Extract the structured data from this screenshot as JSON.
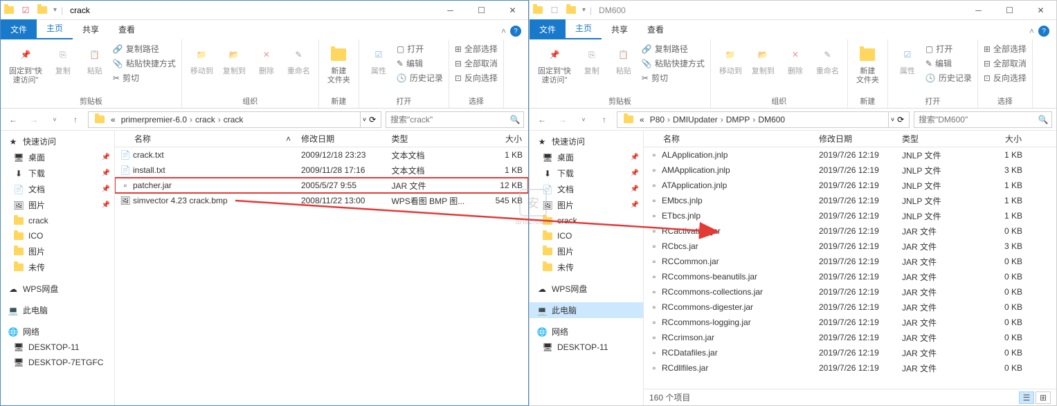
{
  "left": {
    "title": "crack",
    "tabs": {
      "file": "文件",
      "home": "主页",
      "share": "共享",
      "view": "查看"
    },
    "ribbon": {
      "pin": "固定到\"快\n速访问\"",
      "copy": "复制",
      "paste": "粘贴",
      "copypath": "复制路径",
      "pasteshortcut": "粘贴快捷方式",
      "cut": "剪切",
      "clipboard": "剪贴板",
      "moveto": "移动到",
      "copyto": "复制到",
      "delete": "删除",
      "rename": "重命名",
      "organize": "组织",
      "newfolder": "新建\n文件夹",
      "new": "新建",
      "properties": "属性",
      "open_sm": "打开",
      "edit_sm": "编辑",
      "history_sm": "历史记录",
      "open": "打开",
      "selectall": "全部选择",
      "selectnone": "全部取消",
      "invert": "反向选择",
      "select": "选择"
    },
    "breadcrumbs": [
      "«",
      "primerpremier-6.0",
      "crack",
      "crack"
    ],
    "search_placeholder": "搜索\"crack\"",
    "columns": {
      "name": "名称",
      "date": "修改日期",
      "type": "类型",
      "size": "大小"
    },
    "files": [
      {
        "name": "crack.txt",
        "date": "2009/12/18 23:23",
        "type": "文本文档",
        "size": "1 KB",
        "icon": "txt"
      },
      {
        "name": "install.txt",
        "date": "2009/11/28 17:16",
        "type": "文本文档",
        "size": "1 KB",
        "icon": "txt"
      },
      {
        "name": "patcher.jar",
        "date": "2005/5/27 9:55",
        "type": "JAR 文件",
        "size": "12 KB",
        "icon": "jar",
        "highlight": true
      },
      {
        "name": "simvector 4.23 crack.bmp",
        "date": "2008/11/22 13:00",
        "type": "WPS看图 BMP 图...",
        "size": "545 KB",
        "icon": "bmp"
      }
    ],
    "sidebar": [
      {
        "label": "快速访问",
        "icon": "star",
        "top": true
      },
      {
        "label": "桌面",
        "icon": "desktop",
        "pin": true
      },
      {
        "label": "下载",
        "icon": "download",
        "pin": true
      },
      {
        "label": "文档",
        "icon": "doc",
        "pin": true
      },
      {
        "label": "图片",
        "icon": "pic",
        "pin": true
      },
      {
        "label": "crack",
        "icon": "folder"
      },
      {
        "label": "ICO",
        "icon": "folder"
      },
      {
        "label": "图片",
        "icon": "folder"
      },
      {
        "label": "未传",
        "icon": "folder"
      },
      {
        "label": "WPS网盘",
        "icon": "cloud",
        "top": true
      },
      {
        "label": "此电脑",
        "icon": "pc",
        "top": true
      },
      {
        "label": "网络",
        "icon": "network",
        "top": true
      },
      {
        "label": "DESKTOP-11",
        "icon": "pc-sm"
      },
      {
        "label": "DESKTOP-7ETGFC",
        "icon": "pc-sm"
      }
    ]
  },
  "right": {
    "title": "DM600",
    "tabs": {
      "file": "文件",
      "home": "主页",
      "share": "共享",
      "view": "查看"
    },
    "ribbon": {
      "pin": "固定到\"快\n速访问\"",
      "copy": "复制",
      "paste": "粘贴",
      "copypath": "复制路径",
      "pasteshortcut": "粘贴快捷方式",
      "cut": "剪切",
      "clipboard": "剪贴板",
      "moveto": "移动到",
      "copyto": "复制到",
      "delete": "删除",
      "rename": "重命名",
      "organize": "组织",
      "newfolder": "新建\n文件夹",
      "new": "新建",
      "properties": "属性",
      "open_sm": "打开",
      "edit_sm": "编辑",
      "history_sm": "历史记录",
      "open": "打开",
      "selectall": "全部选择",
      "selectnone": "全部取消",
      "invert": "反向选择",
      "select": "选择"
    },
    "breadcrumbs": [
      "«",
      "P80",
      "DMIUpdater",
      "DMPP",
      "DM600"
    ],
    "search_placeholder": "搜索\"DM600\"",
    "columns": {
      "name": "名称",
      "date": "修改日期",
      "type": "类型",
      "size": "大小"
    },
    "files": [
      {
        "name": "ALApplication.jnlp",
        "date": "2019/7/26 12:19",
        "type": "JNLP 文件",
        "size": "1 KB"
      },
      {
        "name": "AMApplication.jnlp",
        "date": "2019/7/26 12:19",
        "type": "JNLP 文件",
        "size": "3 KB"
      },
      {
        "name": "ATApplication.jnlp",
        "date": "2019/7/26 12:19",
        "type": "JNLP 文件",
        "size": "1 KB"
      },
      {
        "name": "EMbcs.jnlp",
        "date": "2019/7/26 12:19",
        "type": "JNLP 文件",
        "size": "1 KB"
      },
      {
        "name": "ETbcs.jnlp",
        "date": "2019/7/26 12:19",
        "type": "JNLP 文件",
        "size": "1 KB"
      },
      {
        "name": "RCactivation.jar",
        "date": "2019/7/26 12:19",
        "type": "JAR 文件",
        "size": "0 KB"
      },
      {
        "name": "RCbcs.jar",
        "date": "2019/7/26 12:19",
        "type": "JAR 文件",
        "size": "3 KB"
      },
      {
        "name": "RCCommon.jar",
        "date": "2019/7/26 12:19",
        "type": "JAR 文件",
        "size": "0 KB"
      },
      {
        "name": "RCcommons-beanutils.jar",
        "date": "2019/7/26 12:19",
        "type": "JAR 文件",
        "size": "0 KB"
      },
      {
        "name": "RCcommons-collections.jar",
        "date": "2019/7/26 12:19",
        "type": "JAR 文件",
        "size": "0 KB"
      },
      {
        "name": "RCcommons-digester.jar",
        "date": "2019/7/26 12:19",
        "type": "JAR 文件",
        "size": "0 KB"
      },
      {
        "name": "RCcommons-logging.jar",
        "date": "2019/7/26 12:19",
        "type": "JAR 文件",
        "size": "0 KB"
      },
      {
        "name": "RCcrimson.jar",
        "date": "2019/7/26 12:19",
        "type": "JAR 文件",
        "size": "0 KB"
      },
      {
        "name": "RCDatafiles.jar",
        "date": "2019/7/26 12:19",
        "type": "JAR 文件",
        "size": "0 KB"
      },
      {
        "name": "RCdllfiles.jar",
        "date": "2019/7/26 12:19",
        "type": "JAR 文件",
        "size": "0 KB"
      }
    ],
    "sidebar": [
      {
        "label": "快速访问",
        "icon": "star",
        "top": true
      },
      {
        "label": "桌面",
        "icon": "desktop",
        "pin": true
      },
      {
        "label": "下载",
        "icon": "download",
        "pin": true
      },
      {
        "label": "文档",
        "icon": "doc",
        "pin": true
      },
      {
        "label": "图片",
        "icon": "pic",
        "pin": true
      },
      {
        "label": "crack",
        "icon": "folder"
      },
      {
        "label": "ICO",
        "icon": "folder"
      },
      {
        "label": "图片",
        "icon": "folder"
      },
      {
        "label": "未传",
        "icon": "folder"
      },
      {
        "label": "WPS网盘",
        "icon": "cloud",
        "top": true
      },
      {
        "label": "此电脑",
        "icon": "pc",
        "top": true,
        "selected": true
      },
      {
        "label": "网络",
        "icon": "network",
        "top": true
      },
      {
        "label": "DESKTOP-11",
        "icon": "pc-sm"
      }
    ],
    "status": "160 个项目"
  },
  "watermark": "anxz.com"
}
